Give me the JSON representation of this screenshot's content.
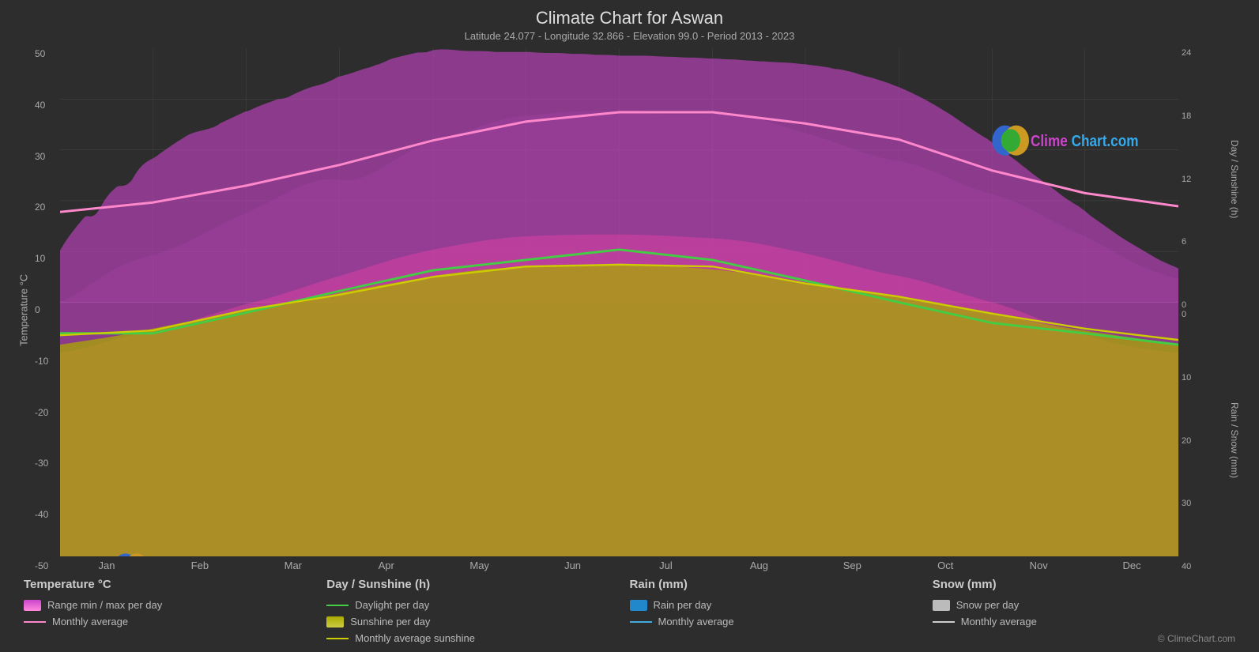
{
  "page": {
    "title": "Climate Chart for Aswan",
    "subtitle": "Latitude 24.077 - Longitude 32.866 - Elevation 99.0 - Period 2013 - 2023",
    "copyright": "© ClimeChart.com",
    "logo_text": "ClimeChart.com"
  },
  "axes": {
    "left_label": "Temperature °C",
    "right_top_label": "Day / Sunshine (h)",
    "right_bottom_label": "Rain / Snow (mm)",
    "left_ticks": [
      "50",
      "40",
      "30",
      "20",
      "10",
      "0",
      "-10",
      "-20",
      "-30",
      "-40",
      "-50"
    ],
    "right_top_ticks": [
      "24",
      "18",
      "12",
      "6",
      "0"
    ],
    "right_bottom_ticks": [
      "0",
      "10",
      "20",
      "30",
      "40"
    ],
    "x_labels": [
      "Jan",
      "Feb",
      "Mar",
      "Apr",
      "May",
      "Jun",
      "Jul",
      "Aug",
      "Sep",
      "Oct",
      "Nov",
      "Dec"
    ]
  },
  "legend": {
    "sections": [
      {
        "title": "Temperature °C",
        "items": [
          {
            "type": "swatch",
            "color": "#cc44bb",
            "label": "Range min / max per day"
          },
          {
            "type": "line",
            "color": "#ff88cc",
            "label": "Monthly average"
          }
        ]
      },
      {
        "title": "Day / Sunshine (h)",
        "items": [
          {
            "type": "line",
            "color": "#44bb44",
            "label": "Daylight per day"
          },
          {
            "type": "swatch",
            "color": "#cccc22",
            "label": "Sunshine per day"
          },
          {
            "type": "line",
            "color": "#bbbb00",
            "label": "Monthly average sunshine"
          }
        ]
      },
      {
        "title": "Rain (mm)",
        "items": [
          {
            "type": "swatch",
            "color": "#2288cc",
            "label": "Rain per day"
          },
          {
            "type": "line",
            "color": "#44aadd",
            "label": "Monthly average"
          }
        ]
      },
      {
        "title": "Snow (mm)",
        "items": [
          {
            "type": "swatch",
            "color": "#bbbbbb",
            "label": "Snow per day"
          },
          {
            "type": "line",
            "color": "#cccccc",
            "label": "Monthly average"
          }
        ]
      }
    ]
  }
}
